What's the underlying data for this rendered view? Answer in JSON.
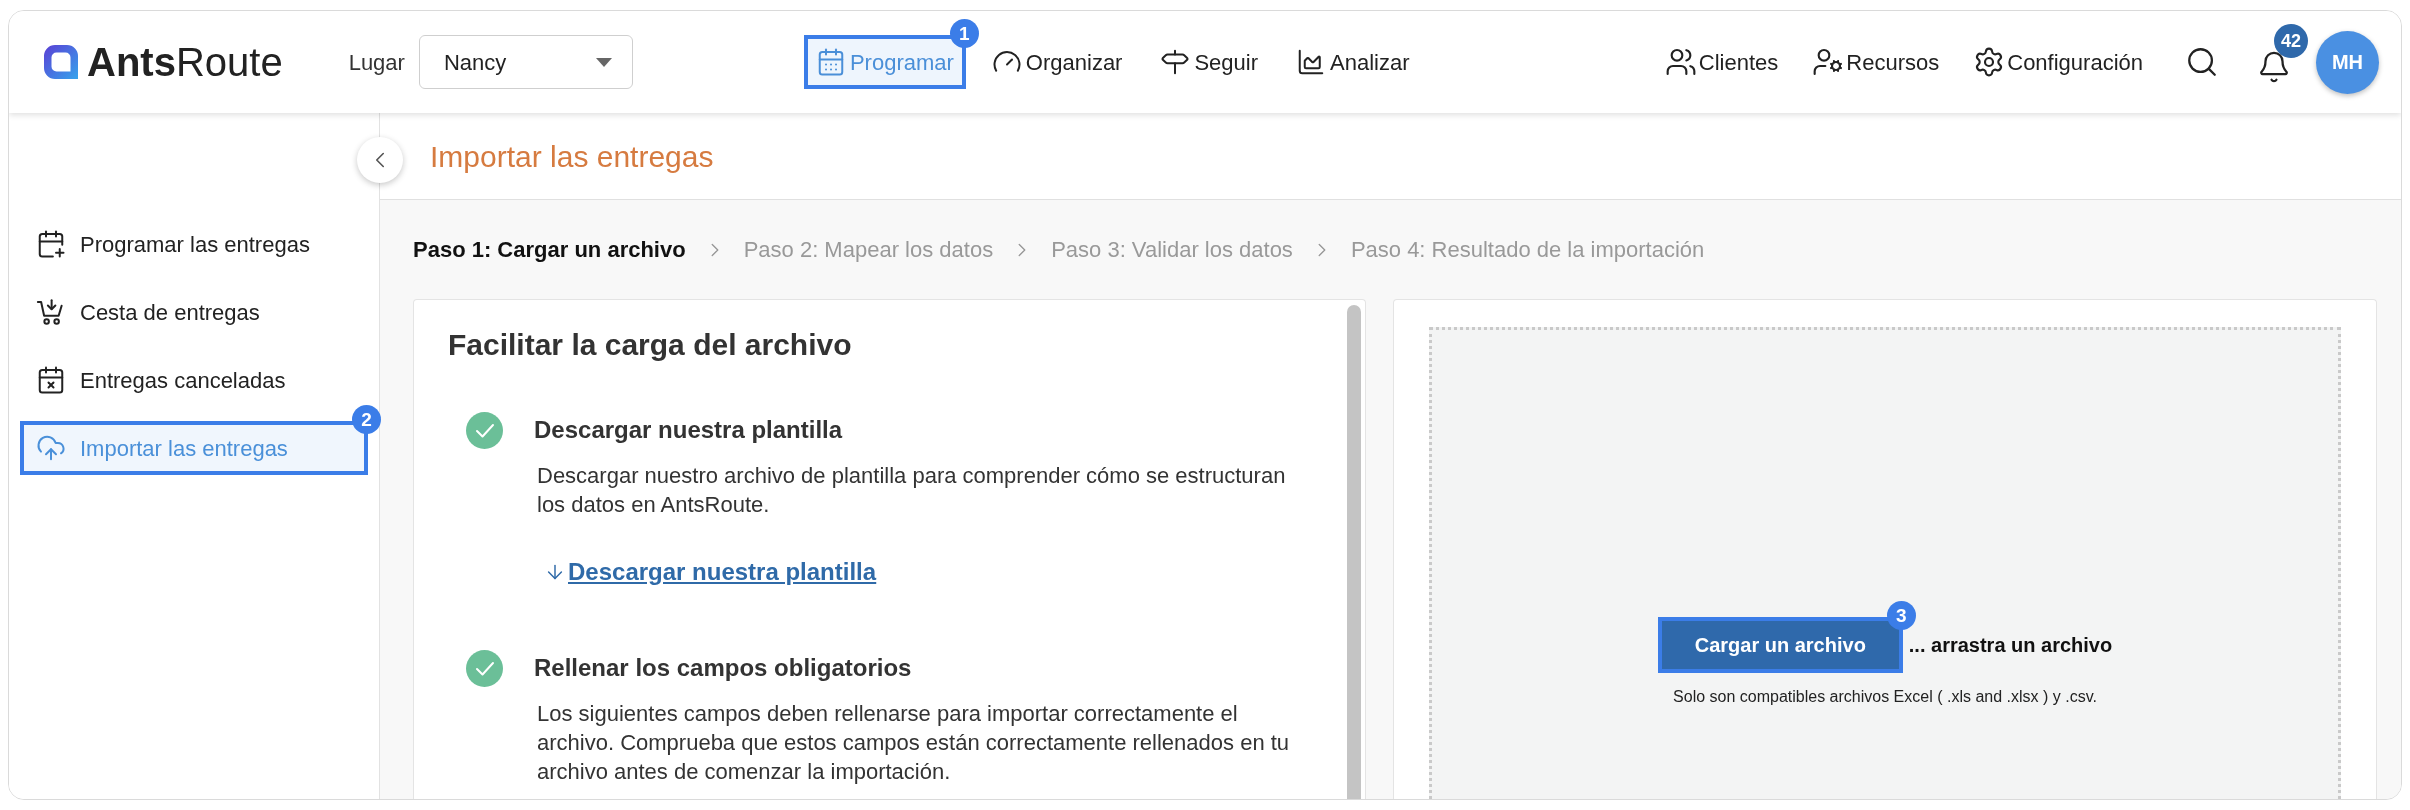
{
  "header": {
    "logo": "**Ants**Route",
    "place": {
      "label": "Lugar",
      "value": "Nancy"
    },
    "nav": [
      {
        "label": "Programar",
        "selected": true,
        "callout": "1"
      },
      {
        "label": "Organizar",
        "selected": false
      },
      {
        "label": "Seguir",
        "selected": false
      },
      {
        "label": "Analizar",
        "selected": false
      }
    ],
    "tools": [
      {
        "label": "Clientes"
      },
      {
        "label": "Recursos"
      },
      {
        "label": "Configuración"
      }
    ],
    "notifications": {
      "count": "42"
    },
    "avatar": {
      "initials": "MH"
    }
  },
  "sidebar": {
    "items": [
      {
        "label": "Programar las entregas",
        "selected": false
      },
      {
        "label": "Cesta de entregas",
        "selected": false
      },
      {
        "label": "Entregas canceladas",
        "selected": false
      },
      {
        "label": "Importar las entregas",
        "selected": true,
        "callout": "2"
      }
    ]
  },
  "page": {
    "title": "Importar las entregas"
  },
  "steps": [
    {
      "label": "Paso 1: Cargar un archivo",
      "selected": true
    },
    {
      "label": "Paso 2: Mapear los datos",
      "selected": false
    },
    {
      "label": "Paso 3: Validar los datos",
      "selected": false
    },
    {
      "label": "Paso 4: Resultado de la importación",
      "selected": false
    }
  ],
  "guide": {
    "title": "Facilitar la carga del archivo",
    "items": [
      {
        "title": "Descargar nuestra plantilla",
        "done": true,
        "text": "Descargar nuestro archivo de plantilla para comprender cómo se estructuran los datos en AntsRoute.",
        "link": "Descargar nuestra plantilla"
      },
      {
        "title": "Rellenar los campos obligatorios",
        "done": true,
        "text": "Los siguientes campos deben rellenarse para importar correctamente el archivo. Comprueba que estos campos están correctamente rellenados en tu archivo antes de comenzar la importación."
      }
    ]
  },
  "upload": {
    "button": "Cargar un archivo",
    "callout": "3",
    "drag_text": "... arrastra un archivo",
    "note": "Solo son compatibles archivos Excel ( .xls and .xlsx ) y .csv."
  }
}
